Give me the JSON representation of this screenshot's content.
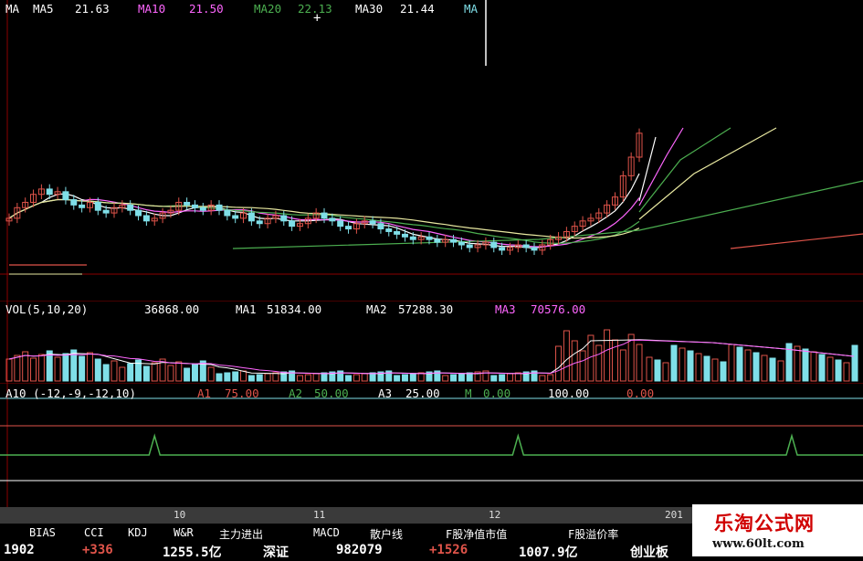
{
  "colors": {
    "up": "#e0544a",
    "down": "#7fdfe8",
    "ma5": "#ffffff",
    "ma10": "#ff66ff",
    "ma20": "#4caf50",
    "ma30": "#e8e8a0",
    "a_line": "#4caf50",
    "grid_red": "#8b0000",
    "label_white": "#ffffff",
    "label_yellow": "#ffff66"
  },
  "price_panel": {
    "ma_label": "MA",
    "ma5_label": "MA5",
    "ma5_value": "21.63",
    "ma10_label": "MA10",
    "ma10_value": "21.50",
    "ma20_label": "MA20",
    "ma20_value": "22.13",
    "ma30_label": "MA30",
    "ma30_value": "21.44",
    "ma60_label": "MA"
  },
  "volume_panel": {
    "title": "VOL(5,10,20)",
    "vol_value": "36868.00",
    "ma1_label": "MA1",
    "ma1_value": "51834.00",
    "ma2_label": "MA2",
    "ma2_value": "57288.30",
    "ma3_label": "MA3",
    "ma3_value": "70576.00"
  },
  "indicator_panel": {
    "title": "A10 (-12,-9,-12,10)",
    "a1_label": "A1",
    "a1_value": "75.00",
    "a2_label": "A2",
    "a2_value": "50.00",
    "a3_label": "A3",
    "a3_value": "25.00",
    "m_label": "M",
    "m_value": "0.00",
    "level_100": "100.00",
    "level_0": "0.00"
  },
  "time_axis": {
    "labels": [
      "10",
      "11",
      "12",
      "201"
    ]
  },
  "indicator_tabs": [
    "BIAS",
    "CCI",
    "KDJ",
    "W&R",
    "主力进出",
    "MACD",
    "散户线",
    "F股净值市值",
    "F股溢价率"
  ],
  "status_bar": {
    "items": [
      "1902",
      "+336",
      "1255.5亿",
      "深证",
      "982079",
      "+1526",
      "1007.9亿",
      "创业板"
    ]
  },
  "watermark": {
    "name": "乐淘公式网",
    "url": "www.60lt.com"
  },
  "chart_data": {
    "type": "candlestick",
    "indicators": [
      "MA5",
      "MA10",
      "MA20",
      "MA30"
    ],
    "closes": [
      20.6,
      21.0,
      21.2,
      21.5,
      21.7,
      21.5,
      21.6,
      21.3,
      21.1,
      21.0,
      21.2,
      20.9,
      20.8,
      21.0,
      21.1,
      20.9,
      20.7,
      20.5,
      20.6,
      20.8,
      20.9,
      21.2,
      21.1,
      21.0,
      20.9,
      21.1,
      20.9,
      20.7,
      20.6,
      20.8,
      20.5,
      20.4,
      20.6,
      20.7,
      20.5,
      20.3,
      20.4,
      20.6,
      20.8,
      20.6,
      20.5,
      20.3,
      20.2,
      20.4,
      20.5,
      20.4,
      20.2,
      20.1,
      20.0,
      19.9,
      19.8,
      19.9,
      19.8,
      19.7,
      19.8,
      19.7,
      19.6,
      19.5,
      19.6,
      19.7,
      19.5,
      19.4,
      19.5,
      19.6,
      19.5,
      19.4,
      19.6,
      19.8,
      19.9,
      20.1,
      20.3,
      20.5,
      20.6,
      20.8,
      21.1,
      21.4,
      22.2,
      22.9,
      23.8
    ],
    "a10_spikes_at_bar": [
      18,
      63,
      103
    ]
  }
}
